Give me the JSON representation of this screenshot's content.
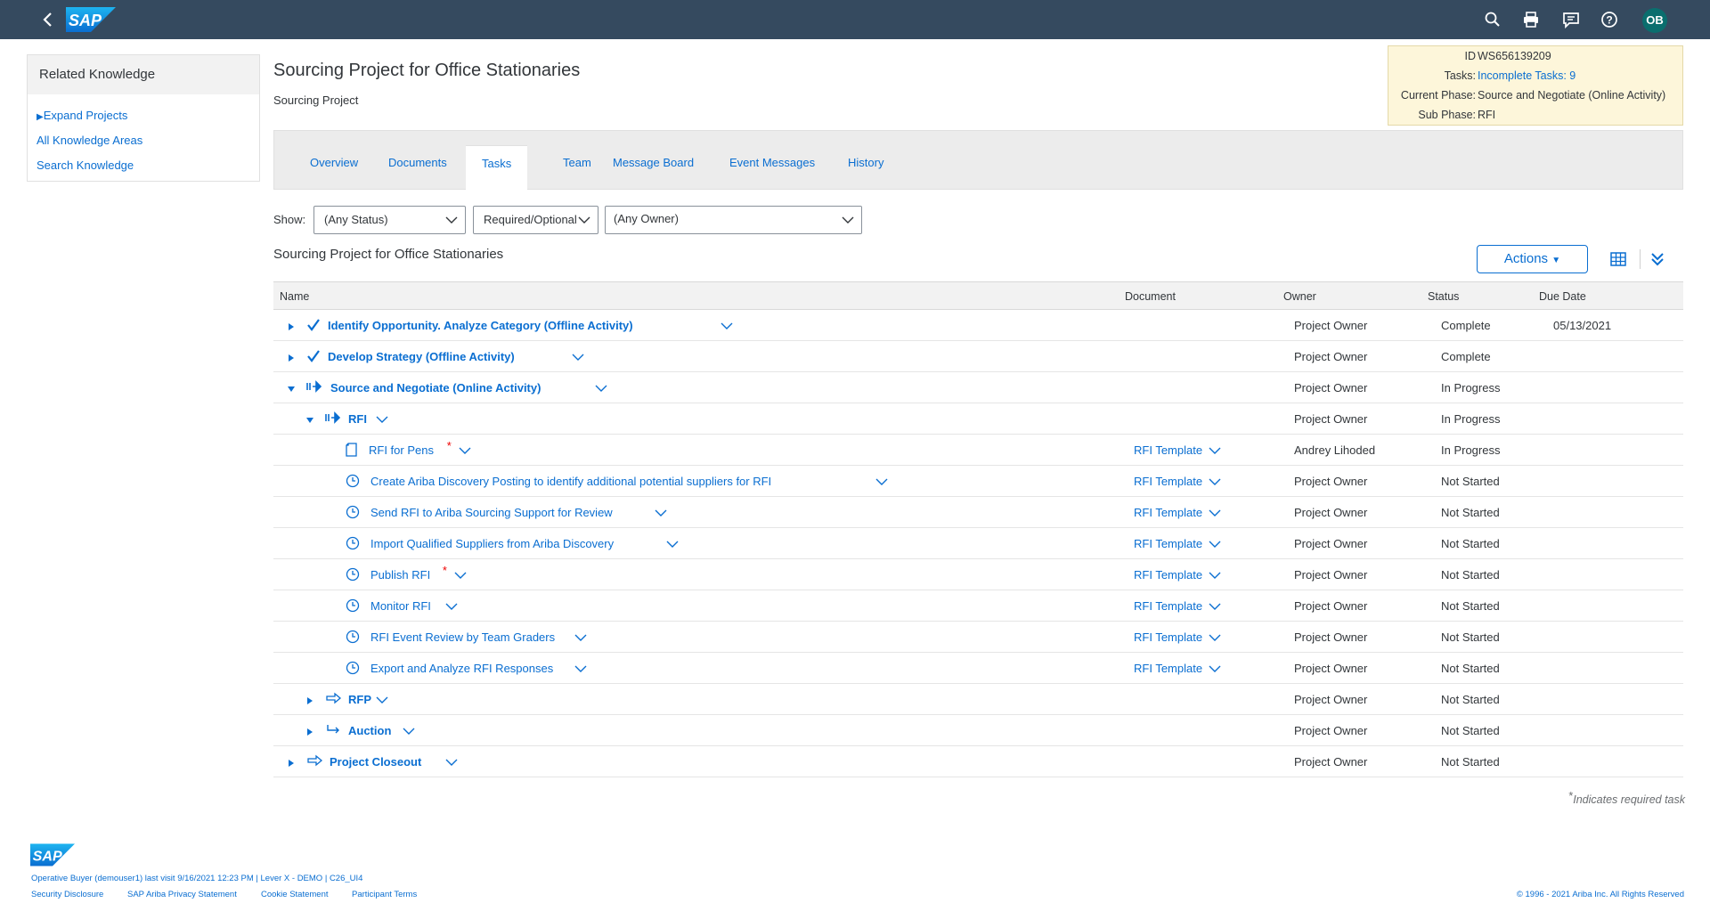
{
  "header": {
    "logo_text": "SAP",
    "avatar_initials": "OB",
    "icons": [
      "back-icon",
      "search-icon",
      "print-icon",
      "notifications-icon",
      "help-icon"
    ]
  },
  "related_knowledge": {
    "title": "Related Knowledge",
    "links": [
      "Expand Projects",
      "All Knowledge Areas",
      "Search Knowledge"
    ]
  },
  "page": {
    "title": "Sourcing Project for Office Stationaries",
    "subtitle": "Sourcing Project"
  },
  "info": {
    "id_label": "ID",
    "id_value": "WS656139209",
    "tasks_label": "Tasks:",
    "tasks_value": "Incomplete Tasks: 9",
    "phase_label": "Current Phase:",
    "phase_value": "Source and Negotiate (Online Activity)",
    "subphase_label": "Sub Phase:",
    "subphase_value": "RFI"
  },
  "tabs": [
    "Overview",
    "Documents",
    "Tasks",
    "Team",
    "Message Board",
    "Event Messages",
    "History"
  ],
  "active_tab": "Tasks",
  "filters": {
    "show_label": "Show:",
    "status": "(Any Status)",
    "required": "Required/Optional",
    "owner": "(Any Owner)"
  },
  "section_title": "Sourcing Project for Office Stationaries",
  "actions_label": "Actions",
  "table": {
    "headers": {
      "name": "Name",
      "document": "Document",
      "owner": "Owner",
      "status": "Status",
      "due": "Due Date"
    },
    "rows": [
      {
        "name": "Identify Opportunity. Analyze Category (Offline Activity)",
        "document": "",
        "owner": "Project Owner",
        "status": "Complete",
        "due": "05/13/2021",
        "icon": "check-icon",
        "level": 0,
        "expander": "collapsed",
        "bold": true
      },
      {
        "name": "Develop Strategy (Offline Activity)",
        "document": "",
        "owner": "Project Owner",
        "status": "Complete",
        "due": "",
        "icon": "check-icon",
        "level": 0,
        "expander": "collapsed",
        "bold": true
      },
      {
        "name": "Source and Negotiate (Online Activity)",
        "document": "",
        "owner": "Project Owner",
        "status": "In Progress",
        "due": "",
        "icon": "in-progress-phase-icon",
        "level": 0,
        "expander": "expanded",
        "bold": true
      },
      {
        "name": "RFI",
        "document": "",
        "owner": "Project Owner",
        "status": "In Progress",
        "due": "",
        "icon": "in-progress-phase-icon",
        "level": 1,
        "expander": "expanded",
        "bold": true
      },
      {
        "name": "RFI for Pens",
        "document": "RFI Template",
        "owner": "Andrey Lihoded",
        "status": "In Progress",
        "due": "",
        "icon": "document-icon",
        "level": 2,
        "required": true
      },
      {
        "name": "Create Ariba Discovery Posting to identify additional potential suppliers for RFI",
        "document": "RFI Template",
        "owner": "Project Owner",
        "status": "Not Started",
        "due": "",
        "icon": "clock-icon",
        "level": 2
      },
      {
        "name": "Send RFI to Ariba Sourcing Support for Review",
        "document": "RFI Template",
        "owner": "Project Owner",
        "status": "Not Started",
        "due": "",
        "icon": "clock-icon",
        "level": 2
      },
      {
        "name": "Import Qualified Suppliers from Ariba Discovery",
        "document": "RFI Template",
        "owner": "Project Owner",
        "status": "Not Started",
        "due": "",
        "icon": "clock-icon",
        "level": 2
      },
      {
        "name": "Publish RFI",
        "document": "RFI Template",
        "owner": "Project Owner",
        "status": "Not Started",
        "due": "",
        "icon": "clock-icon",
        "level": 2,
        "required": true
      },
      {
        "name": "Monitor RFI",
        "document": "RFI Template",
        "owner": "Project Owner",
        "status": "Not Started",
        "due": "",
        "icon": "clock-icon",
        "level": 2
      },
      {
        "name": "RFI Event Review by Team Graders",
        "document": "RFI Template",
        "owner": "Project Owner",
        "status": "Not Started",
        "due": "",
        "icon": "clock-icon",
        "level": 2
      },
      {
        "name": "Export and Analyze RFI Responses",
        "document": "RFI Template",
        "owner": "Project Owner",
        "status": "Not Started",
        "due": "",
        "icon": "clock-icon",
        "level": 2
      },
      {
        "name": "RFP",
        "document": "",
        "owner": "Project Owner",
        "status": "Not Started",
        "due": "",
        "icon": "phase-arrow-icon",
        "level": 1,
        "expander": "collapsed",
        "bold": true
      },
      {
        "name": "Auction",
        "document": "",
        "owner": "Project Owner",
        "status": "Not Started",
        "due": "",
        "icon": "phase-hook-arrow-icon",
        "level": 1,
        "expander": "collapsed",
        "bold": true
      },
      {
        "name": "Project Closeout",
        "document": "",
        "owner": "Project Owner",
        "status": "Not Started",
        "due": "",
        "icon": "phase-arrow-icon",
        "level": 0,
        "expander": "collapsed",
        "bold": true
      }
    ]
  },
  "footer": {
    "required_note": "Indicates required task",
    "required_mark": "*",
    "user_line": "Operative Buyer (demouser1) last visit 9/16/2021 12:23 PM | Lever X - DEMO | C26_UI4",
    "links": [
      "Security Disclosure",
      "SAP Ariba Privacy Statement",
      "Cookie Statement",
      "Participant Terms"
    ],
    "copyright": "© 1996 - 2021 Ariba Inc. All Rights Reserved"
  },
  "colors": {
    "shell": "#354a5f",
    "link": "#0a6ed1",
    "info_bg": "#fdf6da",
    "required": "#e00000"
  }
}
